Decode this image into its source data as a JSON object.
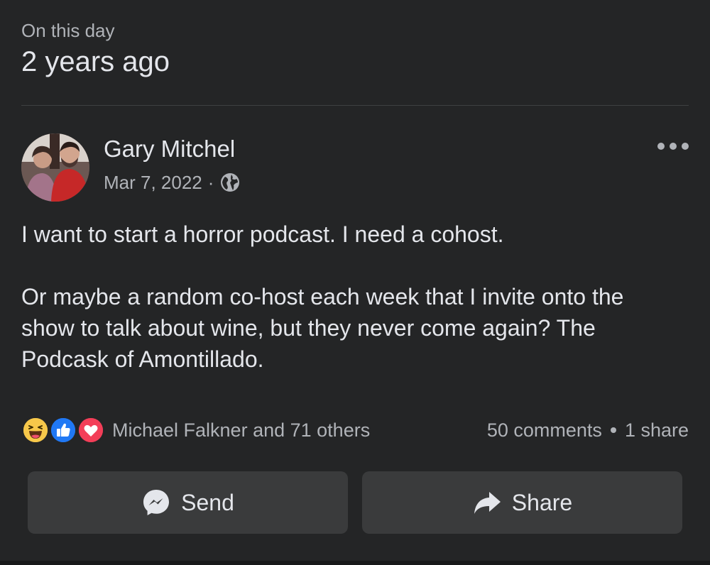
{
  "memory": {
    "label": "On this day",
    "title": "2 years ago"
  },
  "post": {
    "author": "Gary Mitchel",
    "date": "Mar 7, 2022",
    "meta_separator": "·",
    "privacy_icon": "globe-icon",
    "more_icon": "more-options-icon",
    "paragraphs": [
      "I want to start a horror podcast. I need a cohost.",
      "Or maybe a random co-host each week that I invite onto the show to talk about wine, but they never come again? The Podcask of Amontillado."
    ]
  },
  "engagement": {
    "reaction_icons": [
      "haha-reaction-icon",
      "like-reaction-icon",
      "love-reaction-icon"
    ],
    "reactors": "Michael Falkner and 71 others",
    "comments": "50 comments",
    "shares": "1 share"
  },
  "actions": {
    "send_label": "Send",
    "send_icon": "messenger-icon",
    "share_label": "Share",
    "share_icon": "share-arrow-icon"
  },
  "colors": {
    "background": "#242526",
    "button_background": "#3a3b3c",
    "primary_text": "#e4e6eb",
    "secondary_text": "#b0b3b8",
    "like_blue": "#2078f4",
    "love_red": "#f33e58",
    "haha_yellow": "#f7c84a"
  }
}
